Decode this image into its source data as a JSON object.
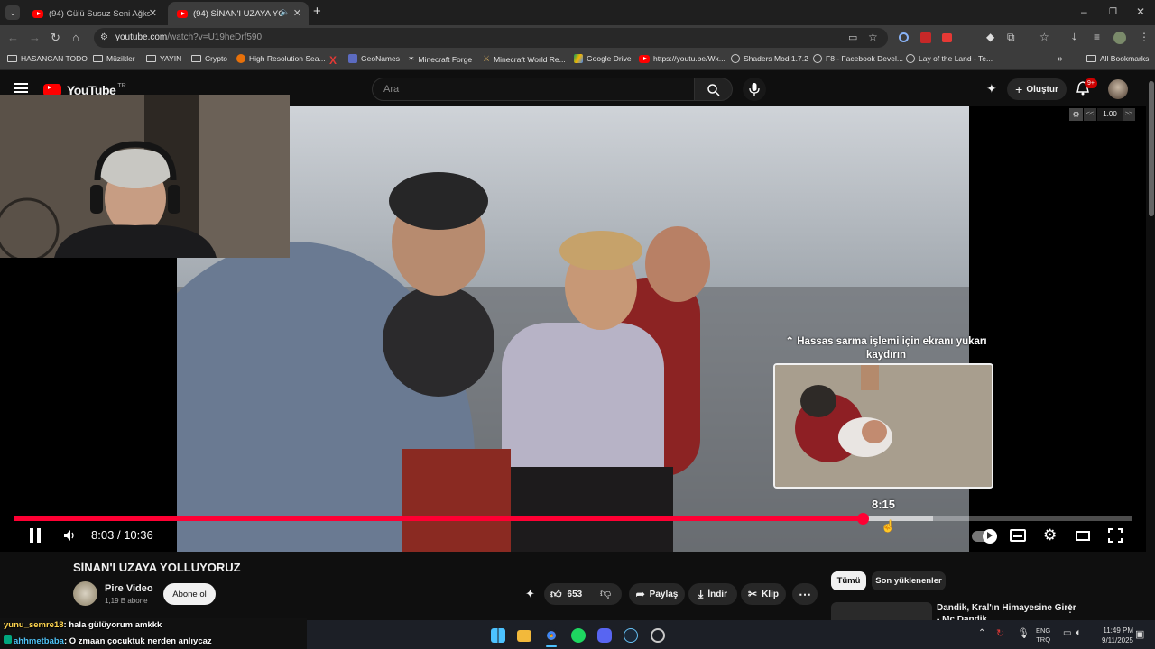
{
  "tabs": [
    {
      "title": "(94) Gülü Susuz Seni Ağksız Bıra"
    },
    {
      "title": "(94) SİNAN'I UZAYA YOLLUYORUZ"
    }
  ],
  "address": {
    "domain": "youtube.com",
    "path": "/watch?v=U19heDrf590"
  },
  "bookmarks": [
    {
      "label": "HASANCAN TODO"
    },
    {
      "label": "Müzikler"
    },
    {
      "label": "YAYIN"
    },
    {
      "label": "Crypto"
    },
    {
      "label": "High Resolution Sea..."
    },
    {
      "label": "GeoNames"
    },
    {
      "label": "Minecraft Forge"
    },
    {
      "label": "Minecraft World Re..."
    },
    {
      "label": "Google Drive"
    },
    {
      "label": "https://youtu.be/Wx..."
    },
    {
      "label": "Shaders Mod 1.7.2"
    },
    {
      "label": "F8 - Facebook Devel..."
    },
    {
      "label": "Lay of the Land - Te..."
    }
  ],
  "all_bookmarks": "All Bookmarks",
  "yt": {
    "logo": "YouTube",
    "region": "TR",
    "search_placeholder": "Ara",
    "create_label": "Oluştur",
    "notif_count": "9+"
  },
  "speed": {
    "value": "1.00",
    "slower": "<<",
    "faster": ">>"
  },
  "player": {
    "time_current": "8:03",
    "time_total": "10:36",
    "time_sep": "/",
    "progress": 0.76,
    "buffered": 0.822,
    "hover_time": "8:15",
    "hint": "Hassas sarma işlemi için ekranı yukarı kaydırın"
  },
  "video": {
    "title": "SİNAN'I UZAYA YOLLUYORUZ",
    "channel": "Pire Video",
    "subs": "1,19 B abone",
    "subscribe": "Abone ol",
    "likes": "653",
    "share": "Paylaş",
    "download": "İndir",
    "clip": "Klip"
  },
  "filters": [
    "Tümü",
    "Son yüklenenler"
  ],
  "related": {
    "title": "Dandik, Kral'ın Himayesine Girer",
    "line2": "- Mc Dandik"
  },
  "chat": [
    {
      "user": "yunu_semre18",
      "msg": ": hala gülüyorum amkkk",
      "color": "#ffd54f"
    },
    {
      "user": "ahhmetbaba",
      "msg": ": O zmaan çocuktuk nerden anlıycaz",
      "color": "#4fc3f7"
    }
  ],
  "tray": {
    "lang1": "ENG",
    "lang2": "TRQ",
    "time": "11:49 PM",
    "date": "9/11/2025"
  },
  "icons": [
    "menu-icon",
    "search-icon",
    "mic-icon",
    "bell-icon",
    "pause-icon",
    "volume-icon",
    "settings-icon",
    "fullscreen-icon",
    "like-icon",
    "dislike-icon",
    "share-icon",
    "download-icon",
    "clip-icon"
  ]
}
